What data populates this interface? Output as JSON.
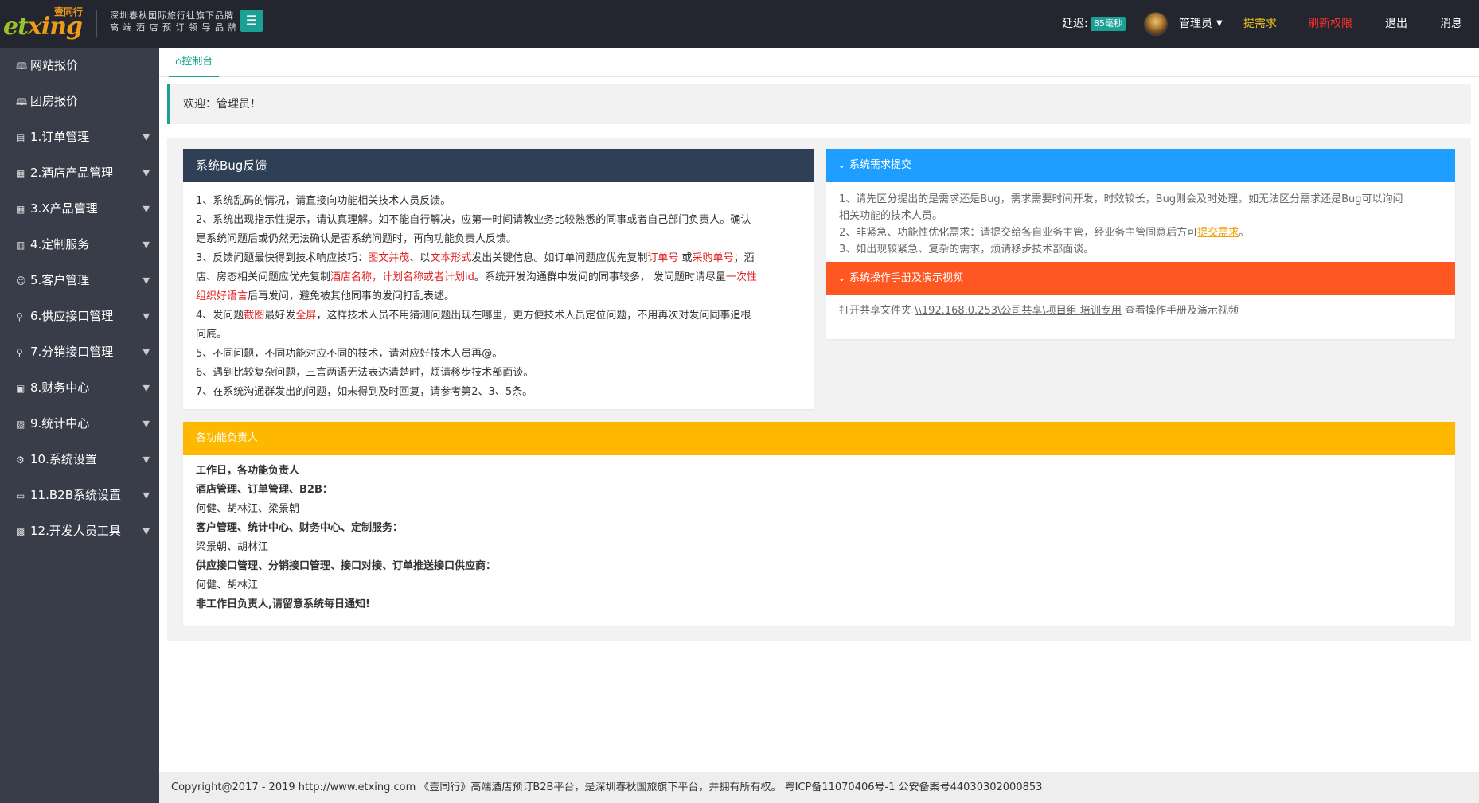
{
  "brand": {
    "logo_text_a": "et",
    "logo_text_b": "xing",
    "logo_cn": "壹同行",
    "sub_line1": "深圳春秋国际旅行社旗下品牌",
    "sub_line2": "高 端 酒 店 预 订 领 导 品 牌"
  },
  "topbar": {
    "menu_icon": "☰",
    "latency_label": "延迟:",
    "latency_value": "85毫秒",
    "admin_name": "管理员",
    "admin_caret": "▼",
    "request_link": "提需求",
    "refresh_link": "刷新权限",
    "logout_link": "退出",
    "message_link": "消息"
  },
  "sidebar": {
    "items": [
      {
        "icon": "🕮",
        "label": "网站报价",
        "has_caret": false
      },
      {
        "icon": "🕮",
        "label": "团房报价",
        "has_caret": false
      },
      {
        "icon": "▤",
        "label": "1.订单管理",
        "has_caret": true
      },
      {
        "icon": "▦",
        "label": "2.酒店产品管理",
        "has_caret": true
      },
      {
        "icon": "▦",
        "label": "3.X产品管理",
        "has_caret": true
      },
      {
        "icon": "▥",
        "label": "4.定制服务",
        "has_caret": true
      },
      {
        "icon": "☺",
        "label": "5.客户管理",
        "has_caret": true
      },
      {
        "icon": "⚲",
        "label": "6.供应接口管理",
        "has_caret": true
      },
      {
        "icon": "⚲",
        "label": "7.分销接口管理",
        "has_caret": true
      },
      {
        "icon": "▣",
        "label": "8.财务中心",
        "has_caret": true
      },
      {
        "icon": "▧",
        "label": "9.统计中心",
        "has_caret": true
      },
      {
        "icon": "⚙",
        "label": "10.系统设置",
        "has_caret": true
      },
      {
        "icon": "▭",
        "label": "11.B2B系统设置",
        "has_caret": true
      },
      {
        "icon": "▩",
        "label": "12.开发人员工具",
        "has_caret": true
      }
    ],
    "caret": "▼"
  },
  "tabs": {
    "home_icon": "⌂",
    "home_label": "控制台"
  },
  "welcome": "欢迎：管理员！",
  "bug_card": {
    "title": "系统Bug反馈",
    "l1": "1、系统乱码的情况，请直接向功能相关技术人员反馈。",
    "l2a": "2、系统出现指示性提示，请认真理解。如不能自行解决，应第一时间请教业务比较熟悉的同事或者自己部门负责人。确认",
    "l2b": "是系统问题后或仍然无法确认是否系统问题时，再向功能负责人反馈。",
    "l3a_1": "3、反馈问题最快得到技术响应技巧：",
    "l3a_r1": "图文并茂",
    "l3a_2": "、以",
    "l3a_r2": "文本形式",
    "l3a_3": "发出关键信息。如订单问题应优先复制",
    "l3a_r3": "订单号",
    "l3a_4": " 或",
    "l3a_r4": "采购单号",
    "l3a_5": "；酒",
    "l3b_1": "店、房态相关问题应优先复制",
    "l3b_r1": "酒店名称，计划名称或者计划id",
    "l3b_2": "。系统开发沟通群中发问的同事较多， 发问题时请尽量",
    "l3b_r2": "一次性",
    "l3c_r1": "组织好语言",
    "l3c_2": "后再发问，避免被其他同事的发问打乱表述。",
    "l4a_1": "4、发问题",
    "l4a_r1": "截图",
    "l4a_2": "最好发",
    "l4a_r2": "全屏",
    "l4a_3": "，这样技术人员不用猜测问题出现在哪里，更方便技术人员定位问题，不用再次对发问同事追根",
    "l4b": "问底。",
    "l5": "5、不同问题，不同功能对应不同的技术，请对应好技术人员再@。",
    "l6": "6、遇到比较复杂问题，三言两语无法表达清楚时，烦请移步技术部面谈。",
    "l7": "7、在系统沟通群发出的问题，如未得到及时回复，请参考第2、3、5条。"
  },
  "req_card": {
    "chevron": "⌄",
    "title": "系统需求提交",
    "l1a": "1、请先区分提出的是需求还是Bug，需求需要时间开发，时效较长，Bug则会及时处理。如无法区分需求还是Bug可以询问",
    "l1b": "相关功能的技术人员。",
    "l2_1": "2、非紧急、功能性优化需求：请提交给各自业务主管，经业务主管同意后方可",
    "l2_link": "提交需求",
    "l2_2": "。",
    "l3": "3、如出现较紧急、复杂的需求，烦请移步技术部面谈。"
  },
  "manual_card": {
    "chevron": "⌄",
    "title": "系统操作手册及演示视频",
    "text_1": "打开共享文件夹 ",
    "path": "\\\\192.168.0.253\\公司共享\\项目组 培训专用",
    "text_2": " 查看操作手册及演示视频"
  },
  "resp_card": {
    "title": "各功能负责人",
    "lines": [
      {
        "text": "工作日，各功能负责人",
        "bold": true
      },
      {
        "text": "酒店管理、订单管理、B2B：",
        "bold": true
      },
      {
        "text": "何健、胡林江、梁景朝",
        "bold": false
      },
      {
        "text": "客户管理、统计中心、财务中心、定制服务：",
        "bold": true
      },
      {
        "text": "梁景朝、胡林江",
        "bold": false
      },
      {
        "text": "供应接口管理、分销接口管理、接口对接、订单推送接口供应商：",
        "bold": true
      },
      {
        "text": "何健、胡林江",
        "bold": false
      },
      {
        "text": "非工作日负责人,请留意系统每日通知!",
        "bold": true
      }
    ]
  },
  "footer": "Copyright@2017 - 2019 http://www.etxing.com 《壹同行》高端酒店预订B2B平台，是深圳春秋国旅旗下平台，并拥有所有权。 粤ICP备11070406号-1 公安备案号44030302000853",
  "colors": {
    "topbar_bg": "#23262e",
    "sidebar_bg": "#393d49",
    "accent": "#1aa094",
    "bug_head": "#2f4056",
    "req_head": "#1e9fff",
    "manual_head": "#ff5722",
    "resp_head": "#ffb800"
  }
}
